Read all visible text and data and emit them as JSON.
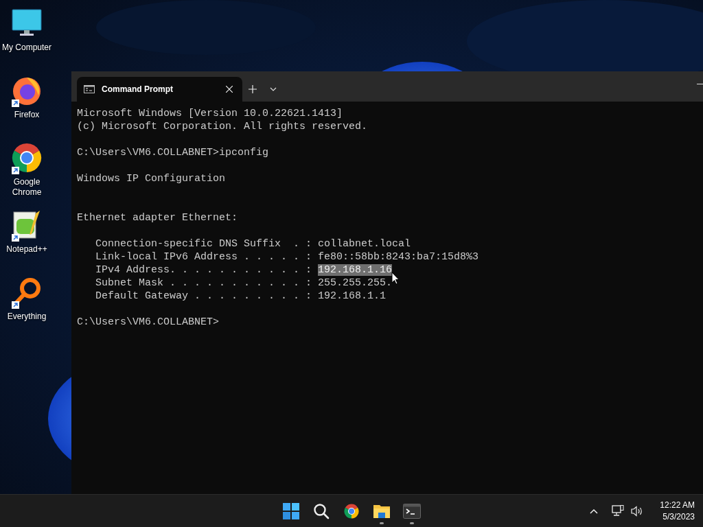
{
  "desktop_icons": [
    {
      "label": "My Computer",
      "kind": "computer",
      "shortcut": false
    },
    {
      "label": "Firefox",
      "kind": "firefox",
      "shortcut": true
    },
    {
      "label": "Google Chrome",
      "kind": "chrome",
      "shortcut": true
    },
    {
      "label": "Notepad++",
      "kind": "notepad",
      "shortcut": true
    },
    {
      "label": "Everything",
      "kind": "everything",
      "shortcut": true
    }
  ],
  "window": {
    "tabs": [
      {
        "title": "Command Prompt",
        "selected": true
      }
    ]
  },
  "terminal": {
    "lines": [
      {
        "kind": "text",
        "text": "Microsoft Windows [Version 10.0.22621.1413]"
      },
      {
        "kind": "text",
        "text": "(c) Microsoft Corporation. All rights reserved."
      },
      {
        "kind": "blank"
      },
      {
        "kind": "text",
        "text": "C:\\Users\\VM6.COLLABNET>ipconfig"
      },
      {
        "kind": "blank"
      },
      {
        "kind": "text",
        "text": "Windows IP Configuration"
      },
      {
        "kind": "blank"
      },
      {
        "kind": "blank"
      },
      {
        "kind": "text",
        "text": "Ethernet adapter Ethernet:"
      },
      {
        "kind": "blank"
      },
      {
        "kind": "text",
        "text": "   Connection-specific DNS Suffix  . : collabnet.local"
      },
      {
        "kind": "text",
        "text": "   Link-local IPv6 Address . . . . . : fe80::58bb:8243:ba7:15d8%3"
      },
      {
        "kind": "segments",
        "parts": [
          {
            "text": "   IPv4 Address. . . . . . . . . . . : ",
            "selected": false
          },
          {
            "text": "192.168.1.16",
            "selected": true
          }
        ]
      },
      {
        "kind": "text",
        "text": "   Subnet Mask . . . . . . . . . . . : 255.255.255."
      },
      {
        "kind": "text",
        "text": "   Default Gateway . . . . . . . . . : 192.168.1.1"
      },
      {
        "kind": "blank"
      },
      {
        "kind": "text",
        "text": "C:\\Users\\VM6.COLLABNET>"
      }
    ]
  },
  "taskbar": {
    "apps": [
      {
        "kind": "start",
        "running": false
      },
      {
        "kind": "search",
        "running": false
      },
      {
        "kind": "chrome",
        "running": false
      },
      {
        "kind": "explorer",
        "running": true
      },
      {
        "kind": "terminal",
        "running": true
      }
    ],
    "clock": {
      "time": "12:22 AM",
      "date": "5/3/2023"
    }
  }
}
